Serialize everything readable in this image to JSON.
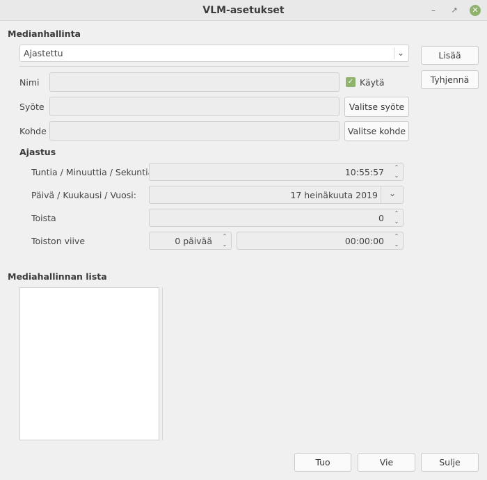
{
  "window": {
    "title": "VLM-asetukset",
    "minimize_icon": "minimize-icon",
    "restore_icon": "restore-icon",
    "close_icon": "close-icon",
    "accent": "#8fb26c"
  },
  "media_manager": {
    "section_title": "Medianhallinta",
    "type_selected": "Ajastettu",
    "add_button": "Lisää",
    "clear_button": "Tyhjennä",
    "name_label": "Nimi",
    "name_value": "",
    "enable_label": "Käytä",
    "enable_checked": true,
    "input_label": "Syöte",
    "input_value": "",
    "select_input_button": "Valitse syöte",
    "output_label": "Kohde",
    "output_value": "",
    "select_output_button": "Valitse kohde"
  },
  "schedule": {
    "section_title": "Ajastus",
    "time_label": "Tuntia / Minuuttia / Sekuntia:",
    "time_value": "10:55:57",
    "date_label": "Päivä / Kuukausi / Vuosi:",
    "date_value": "17 heinäkuuta 2019",
    "repeat_label": "Toista",
    "repeat_value": "0",
    "repeat_delay_label": "Toiston viive",
    "repeat_delay_days": "0 päivää",
    "repeat_delay_time": "00:00:00"
  },
  "list": {
    "section_title": "Mediahallinnan lista",
    "items": []
  },
  "footer": {
    "import_button": "Tuo",
    "export_button": "Vie",
    "close_button": "Sulje"
  }
}
